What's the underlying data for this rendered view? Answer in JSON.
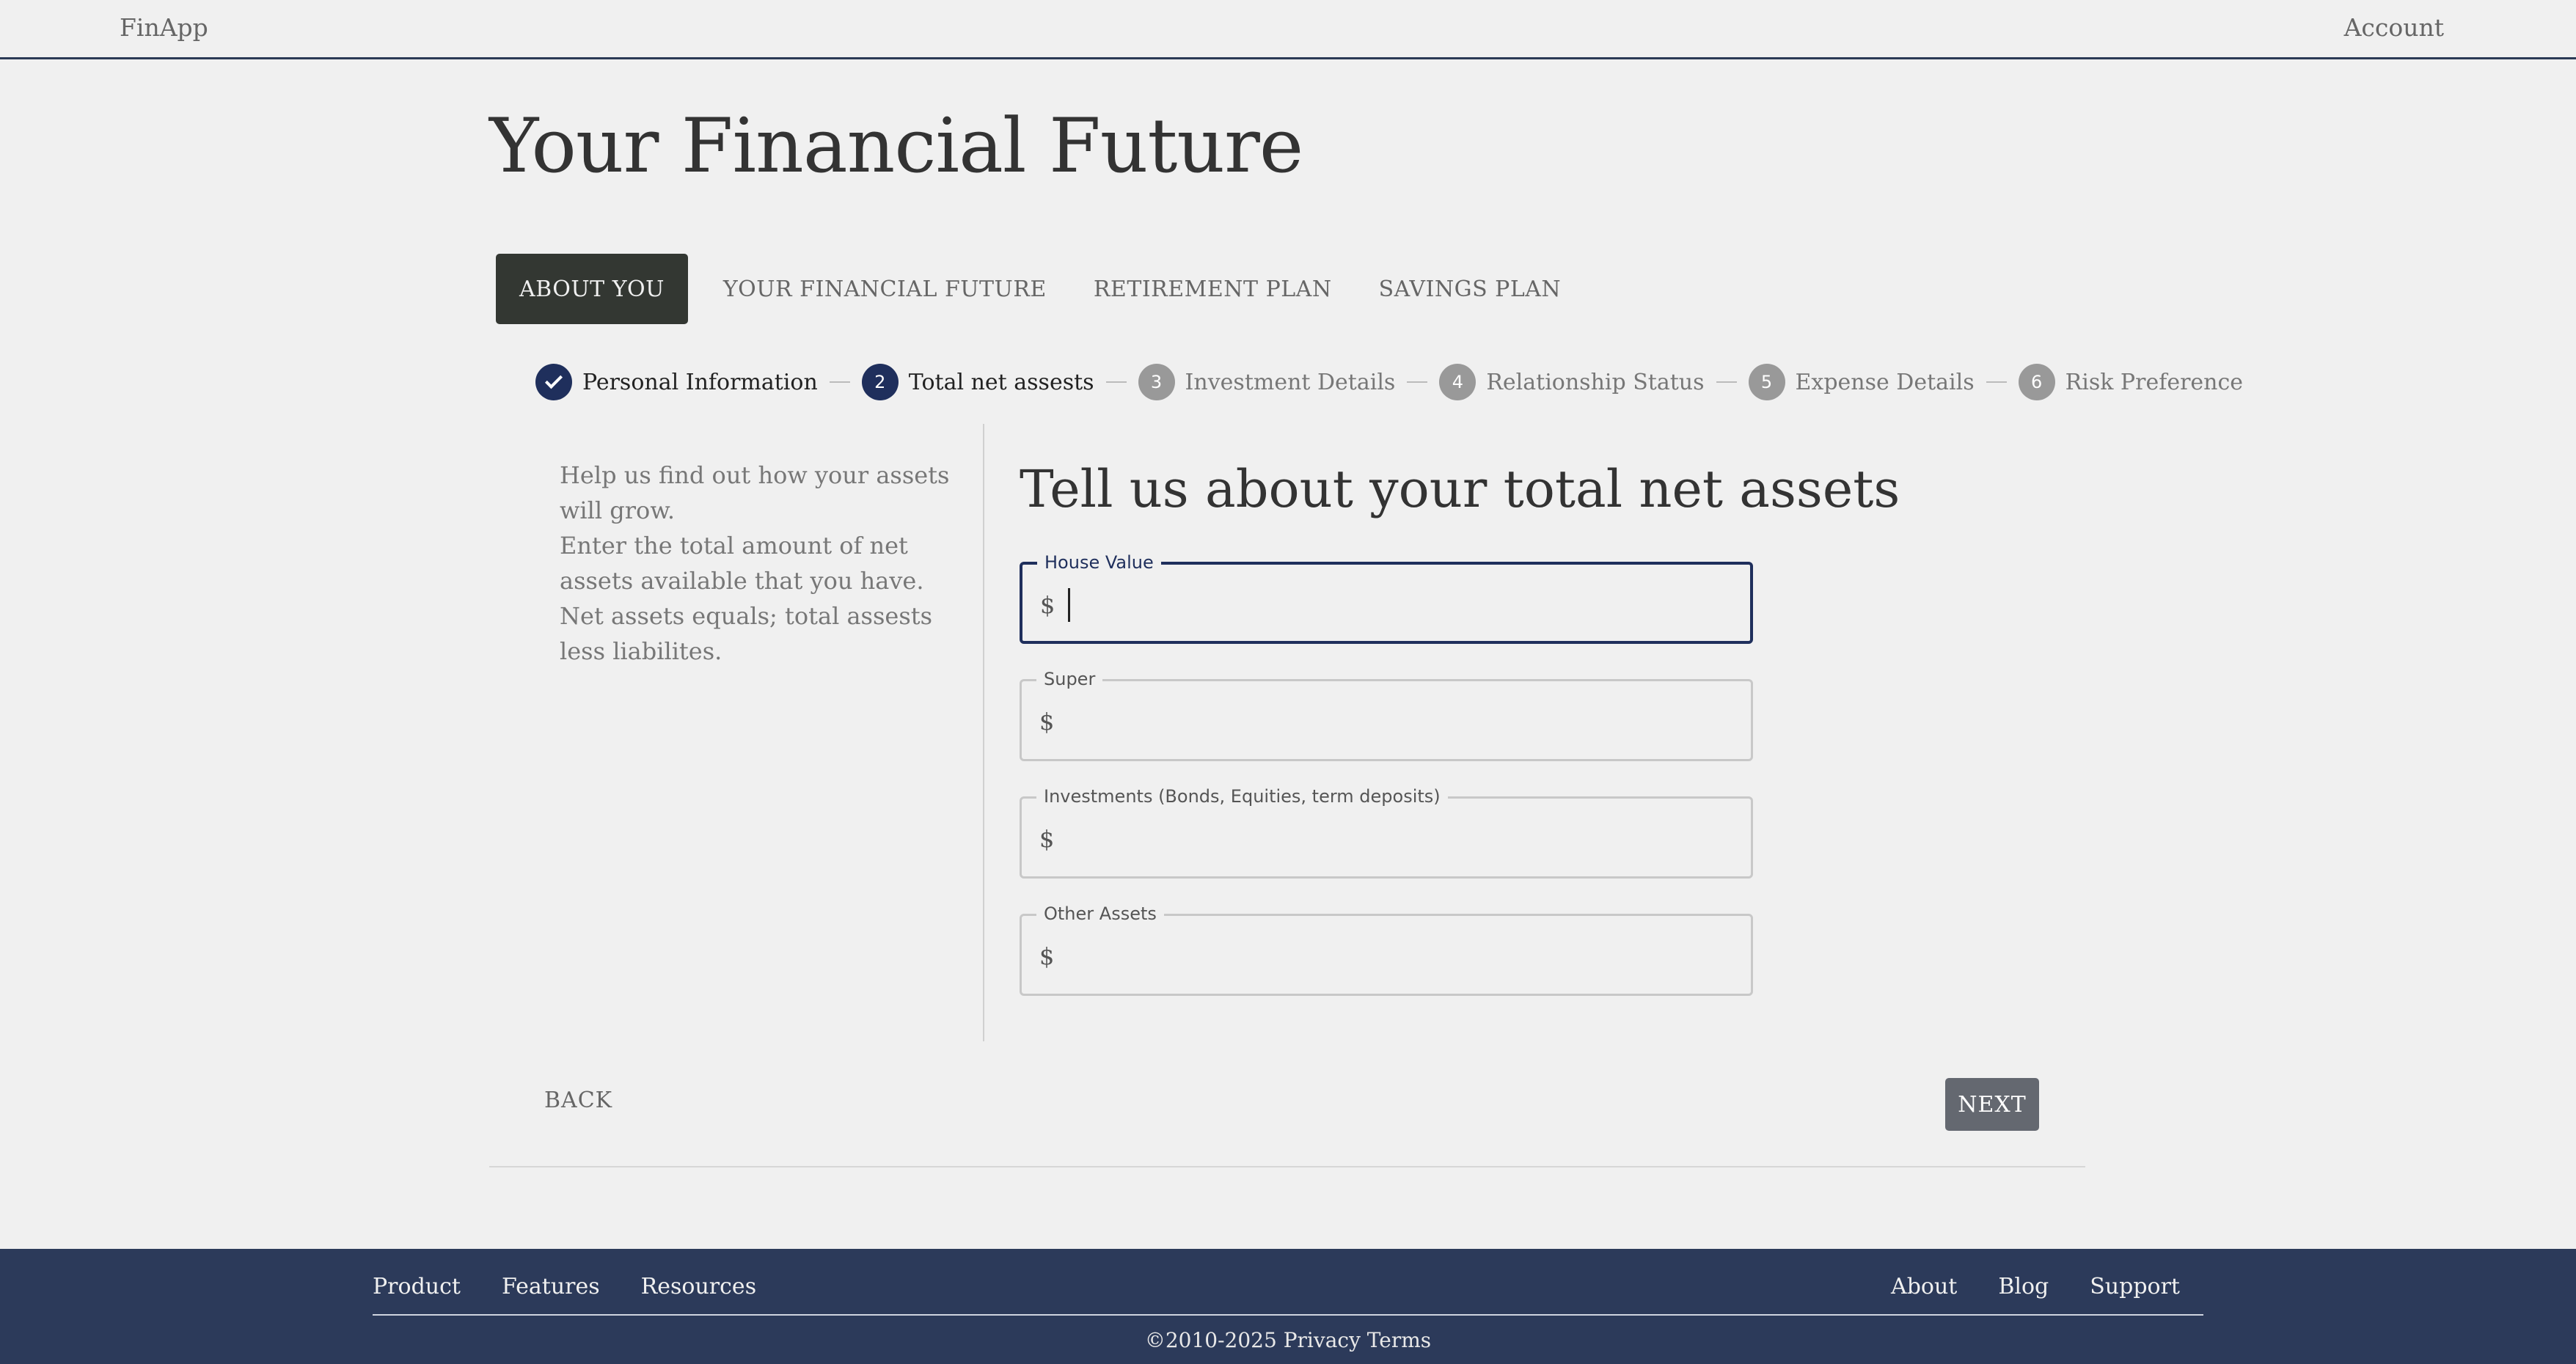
{
  "header": {
    "brand": "FinApp",
    "account": "Account"
  },
  "page_title": "Your Financial Future",
  "tabs": [
    {
      "label": "ABOUT YOU",
      "active": true
    },
    {
      "label": "YOUR FINANCIAL FUTURE",
      "active": false
    },
    {
      "label": "RETIREMENT PLAN",
      "active": false
    },
    {
      "label": "SAVINGS PLAN",
      "active": false
    }
  ],
  "steps": [
    {
      "number": "1",
      "label": "Personal Information",
      "state": "done"
    },
    {
      "number": "2",
      "label": "Total net assests",
      "state": "current"
    },
    {
      "number": "3",
      "label": "Investment Details",
      "state": "pending"
    },
    {
      "number": "4",
      "label": "Relationship Status",
      "state": "pending"
    },
    {
      "number": "5",
      "label": "Expense Details",
      "state": "pending"
    },
    {
      "number": "6",
      "label": "Risk Preference",
      "state": "pending"
    }
  ],
  "help": {
    "line1": "Help us find out how your assets will grow.",
    "line2": "Enter the total amount of net assets available that you have. Net assets equals; total assests less liabilites."
  },
  "form": {
    "title": "Tell us about your total net assets",
    "currency": "$",
    "fields": [
      {
        "label": "House Value",
        "value": ""
      },
      {
        "label": "Super",
        "value": ""
      },
      {
        "label": "Investments (Bonds, Equities, term deposits)",
        "value": ""
      },
      {
        "label": "Other Assets",
        "value": ""
      }
    ]
  },
  "actions": {
    "back": "BACK",
    "next": "NEXT"
  },
  "footer": {
    "left": [
      "Product",
      "Features",
      "Resources"
    ],
    "right": [
      "About",
      "Blog",
      "Support"
    ],
    "copyright": "©2010-2025 Privacy Terms"
  },
  "colors": {
    "primary": "#1f2f5c",
    "footer_bg": "#2c3a5a",
    "tab_active": "#333732",
    "next_bg": "#646870"
  }
}
